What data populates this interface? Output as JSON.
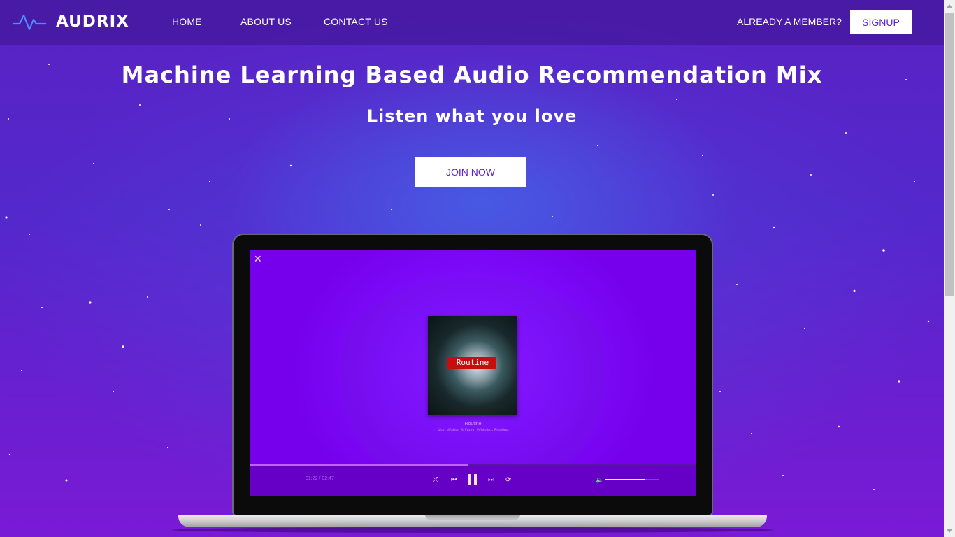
{
  "brand": {
    "name": "AUDRIX",
    "icon": "waveform-icon"
  },
  "nav": {
    "links": [
      {
        "label": "HOME"
      },
      {
        "label": "ABOUT US"
      },
      {
        "label": "CONTACT US"
      }
    ],
    "member_label": "ALREADY A MEMBER?",
    "signup_label": "SIGNUP"
  },
  "hero": {
    "title": "Machine Learning Based Audio Recommendation Mix",
    "subtitle": "Listen what you love",
    "cta_label": "JOIN NOW"
  },
  "player": {
    "close_icon": "close-icon",
    "album_label": "Routine",
    "track_title": "Routine",
    "track_artist": "Alan Walker & David Whistle - Routine",
    "time": "01:22 / 02:47",
    "progress": 0.49,
    "volume": 0.75,
    "controls": [
      "shuffle-icon",
      "previous-icon",
      "pause-icon",
      "next-icon",
      "repeat-icon",
      "volume-icon"
    ]
  },
  "colors": {
    "accent": "#5b1fd1",
    "screen": "#7e10ff",
    "player_bar": "#6600c6"
  }
}
